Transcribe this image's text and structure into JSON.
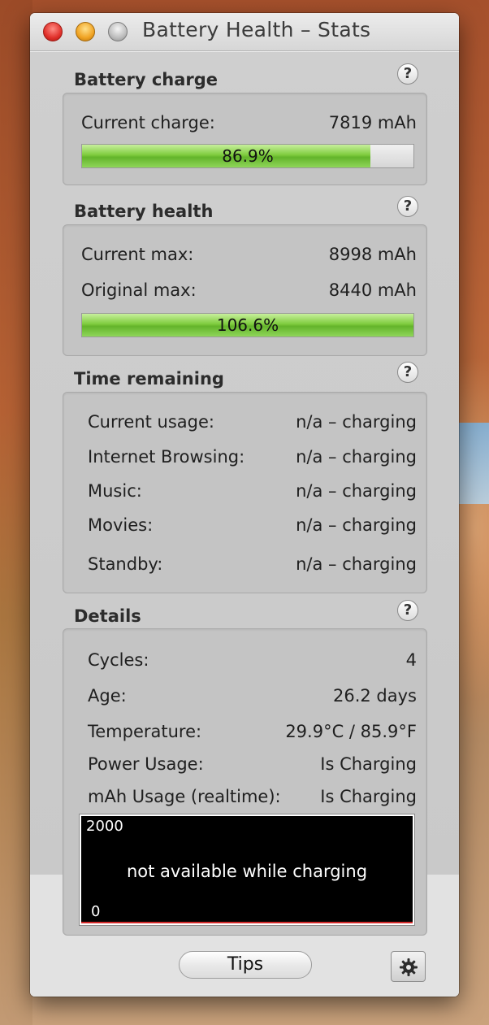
{
  "window": {
    "title": "Battery Health – Stats"
  },
  "help": {
    "glyph": "?"
  },
  "battery_charge": {
    "title": "Battery charge",
    "current_label": "Current charge:",
    "current_value": "7819 mAh",
    "percent_text": "86.9%",
    "percent": 86.9
  },
  "battery_health": {
    "title": "Battery health",
    "max_label": "Current max:",
    "max_value": "8998 mAh",
    "orig_label": "Original max:",
    "orig_value": "8440 mAh",
    "percent_text": "106.6%",
    "percent": 100
  },
  "time_remaining": {
    "title": "Time remaining",
    "rows": [
      {
        "label": "Current usage:",
        "value": "n/a – charging"
      },
      {
        "label": "Internet Browsing:",
        "value": "n/a – charging"
      },
      {
        "label": "Music:",
        "value": "n/a – charging"
      },
      {
        "label": "Movies:",
        "value": "n/a – charging"
      },
      {
        "label": "Standby:",
        "value": "n/a – charging"
      }
    ]
  },
  "details": {
    "title": "Details",
    "rows": [
      {
        "label": "Cycles:",
        "value": "4"
      },
      {
        "label": "Age:",
        "value": "26.2 days"
      },
      {
        "label": "Temperature:",
        "value": "29.9°C / 85.9°F"
      },
      {
        "label": "Power Usage:",
        "value": "Is Charging"
      },
      {
        "label": "mAh Usage (realtime):",
        "value": "Is Charging"
      }
    ],
    "graph": {
      "max_label": "2000",
      "min_label": "0",
      "message": "not available while charging"
    }
  },
  "footer": {
    "tips_label": "Tips",
    "settings_icon": "gear-icon"
  },
  "colors": {
    "bar_green": "#7fcc3e",
    "graph_bg": "#000000",
    "graph_baseline": "#d32a2a"
  }
}
